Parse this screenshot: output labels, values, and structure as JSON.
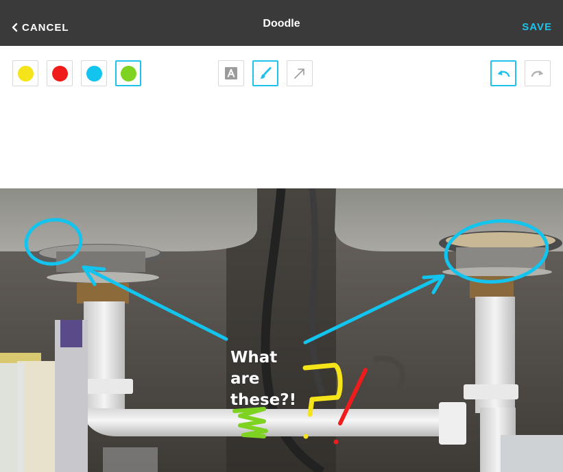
{
  "header": {
    "cancel_label": "CANCEL",
    "title": "Doodle",
    "save_label": "SAVE"
  },
  "palette": {
    "colors": [
      {
        "name": "yellow",
        "hex": "#f5e41a"
      },
      {
        "name": "red",
        "hex": "#f01c1c"
      },
      {
        "name": "cyan",
        "hex": "#12c4ee"
      },
      {
        "name": "green",
        "hex": "#7ed321"
      }
    ],
    "selected": "green"
  },
  "tools": {
    "items": [
      "text-tool",
      "brush-tool",
      "arrow-tool"
    ],
    "selected": "brush-tool"
  },
  "history": {
    "undo_enabled": true,
    "redo_enabled": false
  },
  "canvas": {
    "annotation_lines": [
      "What",
      "are",
      "these?!"
    ]
  },
  "accent_color": "#1ec3ec",
  "header_bg": "#3a3a3a"
}
